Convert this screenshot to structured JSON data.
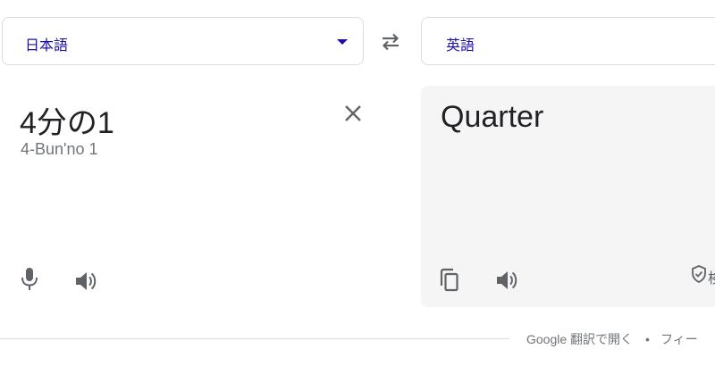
{
  "languages": {
    "source": "日本語",
    "target": "英語"
  },
  "source": {
    "text": "4分の1",
    "romanization": "4-Bun'no 1"
  },
  "target": {
    "text": "Quarter",
    "verified_label": "検"
  },
  "footer": {
    "open_link": "Google 翻訳で開く",
    "separator": "•",
    "feedback_link": "フィー"
  },
  "colors": {
    "link_blue": "#1a0dab",
    "icon_gray": "#5f6368",
    "panel_bg": "#f5f5f5",
    "border": "#dadce0"
  }
}
